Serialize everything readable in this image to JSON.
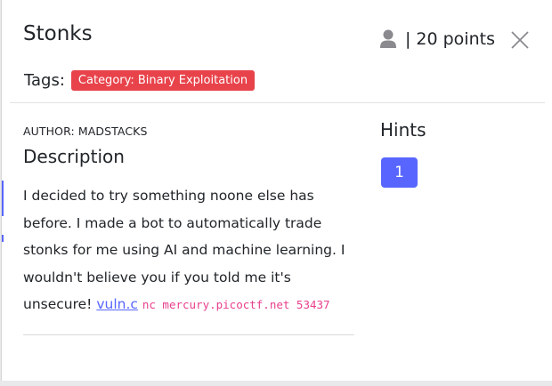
{
  "challenge": {
    "title": "Stonks",
    "points_separator": "|",
    "points_label": "20 points",
    "tags_label": "Tags:",
    "tag": "Category: Binary Exploitation",
    "author": "AUTHOR: MADSTACKS",
    "description_heading": "Description",
    "description_text": "I decided to try something noone else has before. I made a bot to automatically trade stonks for me using AI and machine learning. I wouldn't believe you if you told me it's unsecure!",
    "file_link": "vuln.c",
    "connect_command": "nc mercury.picoctf.net 53437"
  },
  "hints": {
    "heading": "Hints",
    "items": [
      "1"
    ]
  },
  "icons": {
    "user": "user-icon",
    "close": "close-icon"
  },
  "colors": {
    "accent": "#5866ff",
    "tag_bg": "#e8434b",
    "code": "#e83e8c"
  }
}
